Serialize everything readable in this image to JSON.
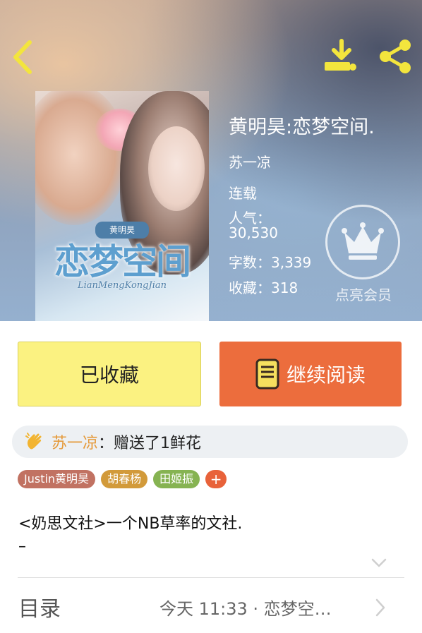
{
  "header": {
    "back_icon": "chevron-left-icon",
    "download_icon": "download-icon",
    "share_icon": "share-icon"
  },
  "book": {
    "title": "黄明昊:恋梦空间.",
    "author": "苏一凉",
    "status": "连载",
    "popularity_label": "人气：",
    "popularity_value": "30,530",
    "word_count": "字数：3,339",
    "favorites": "收藏：318",
    "cover": {
      "title_art": "恋梦空间",
      "subtitle_art": "LianMengKongJian",
      "badge_art": "黄明昊"
    }
  },
  "vip": {
    "label": "点亮会员",
    "icon": "crown-icon"
  },
  "actions": {
    "favorite_label": "已收藏",
    "read_label": "继续阅读"
  },
  "gift": {
    "user": "苏一凉",
    "text": "：赠送了1鲜花"
  },
  "tags": [
    "Justin黄明昊",
    "胡春杨",
    "田姬振"
  ],
  "tag_add": "+",
  "description": {
    "line1": "<奶思文社>一个NB草率的文社.",
    "line2": "–"
  },
  "toc": {
    "label": "目录",
    "latest": "今天 11:33 · 恋梦空…"
  },
  "colors": {
    "accent_orange": "#ec6d3d",
    "favorite_yellow": "#fbf281",
    "icon_yellow": "#f3e53d"
  }
}
